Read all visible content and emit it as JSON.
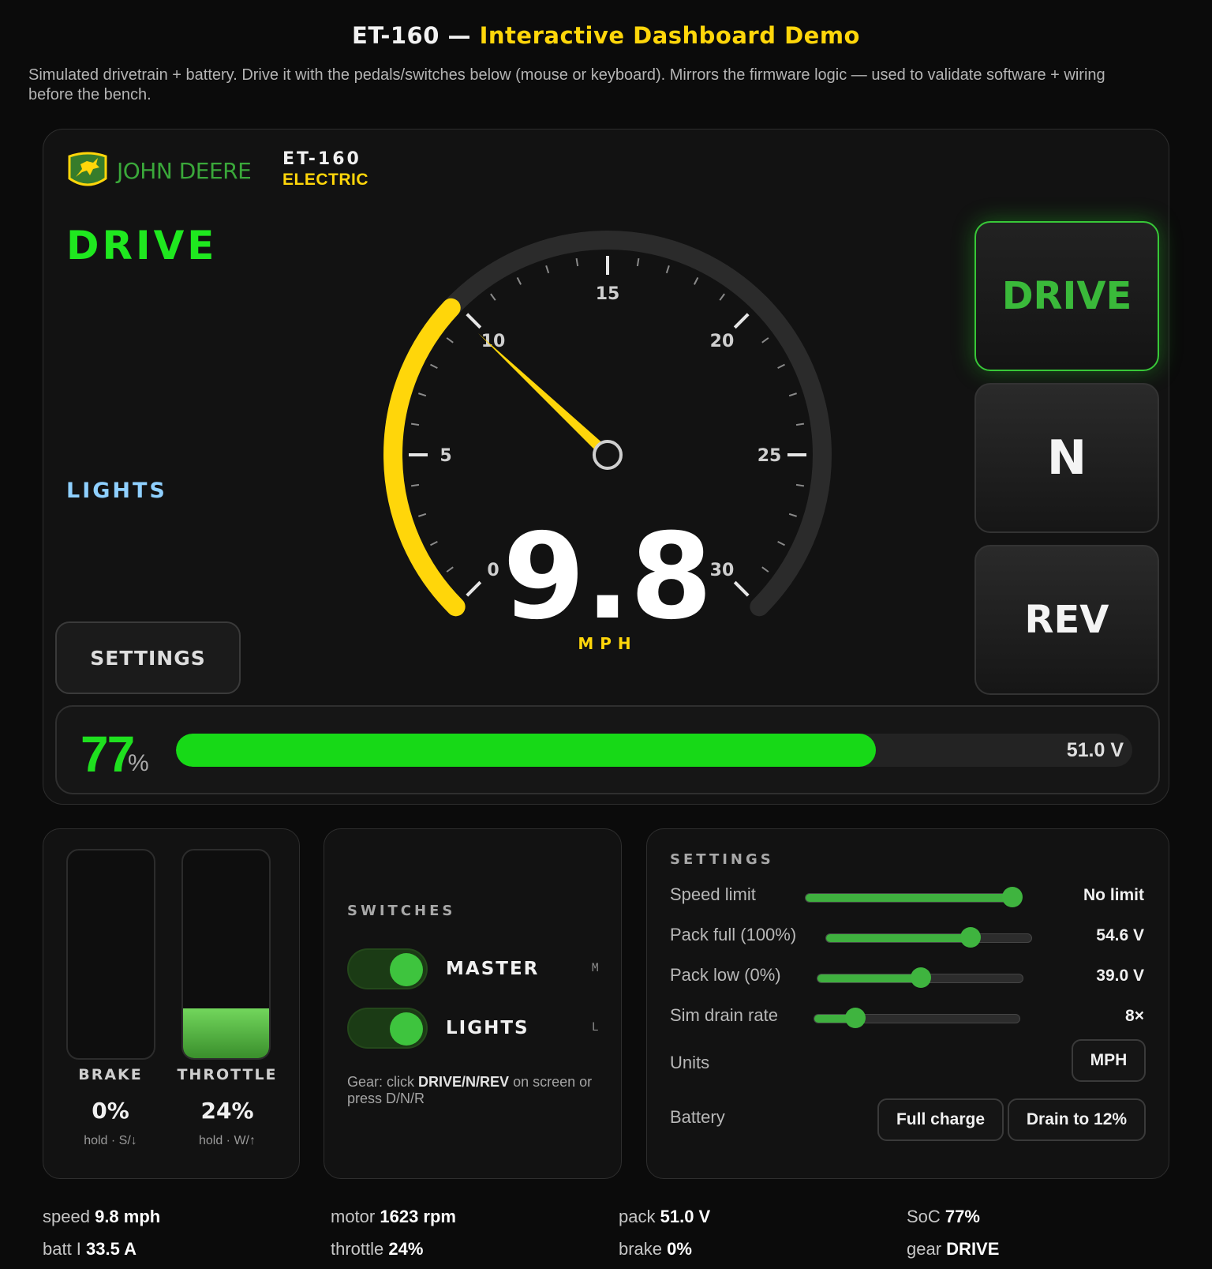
{
  "header": {
    "title_prefix": "ET-160 —",
    "title_highlight": "Interactive Dashboard Demo",
    "subtitle": "Simulated drivetrain + battery. Drive it with the pedals/switches below (mouse or keyboard). Mirrors the firmware logic — used to validate software + wiring before the bench."
  },
  "dash": {
    "brand": "JOHN DEERE",
    "model": "ET-160",
    "model_sub": "ELECTRIC",
    "gear_label": "DRIVE",
    "lights_indicator": "LIGHTS",
    "settings_button": "SETTINGS",
    "speed": "9.8",
    "speed_value": 9.8,
    "speed_max": 30,
    "speed_unit": "MPH",
    "ticks": [
      "0",
      "5",
      "10",
      "15",
      "20",
      "25",
      "30"
    ],
    "gear_buttons": {
      "drive": "DRIVE",
      "neutral": "N",
      "reverse": "REV"
    },
    "active_gear": "drive",
    "battery": {
      "percent": "77",
      "percent_value": 77,
      "percent_sign": "%",
      "voltage": "51.0 V"
    },
    "colors": {
      "accent_yellow": "#ffd60a",
      "accent_green": "#1fe81f",
      "brand_green": "#367c2b"
    }
  },
  "pedals": {
    "brake": {
      "label": "BRAKE",
      "value": "0%",
      "level": 0,
      "hint": "hold · S/↓"
    },
    "throttle": {
      "label": "THROTTLE",
      "value": "24%",
      "level": 24,
      "hint": "hold · W/↑"
    }
  },
  "switches": {
    "title": "SWITCHES",
    "items": [
      {
        "label": "MASTER",
        "key": "M",
        "on": true
      },
      {
        "label": "LIGHTS",
        "key": "L",
        "on": true
      }
    ],
    "gear_hint_prefix": "Gear: click ",
    "gear_hint_bold": "DRIVE/N/REV",
    "gear_hint_suffix": " on screen or press D/N/R"
  },
  "settings": {
    "title": "SETTINGS",
    "sliders": [
      {
        "label": "Speed limit",
        "value": "No limit",
        "level": 1.0
      },
      {
        "label": "Pack full (100%)",
        "value": "54.6 V",
        "level": 0.7
      },
      {
        "label": "Pack low (0%)",
        "value": "39.0 V",
        "level": 0.5
      },
      {
        "label": "Sim drain rate",
        "value": "8×",
        "level": 0.2
      }
    ],
    "units_label": "Units",
    "units_value": "MPH",
    "battery_label": "Battery",
    "full_charge": "Full charge",
    "drain": "Drain to 12%"
  },
  "telemetry": {
    "speed_key": "speed",
    "speed_val": "9.8 mph",
    "motor_key": "motor",
    "motor_val": "1623 rpm",
    "pack_key": "pack",
    "pack_val": "51.0 V",
    "soc_key": "SoC",
    "soc_val": "77%",
    "batt_key": "batt I",
    "batt_val": "33.5 A",
    "throttle_key": "throttle",
    "throttle_val": "24%",
    "brake_key": "brake",
    "brake_val": "0%",
    "gear_key": "gear",
    "gear_val": "DRIVE"
  }
}
